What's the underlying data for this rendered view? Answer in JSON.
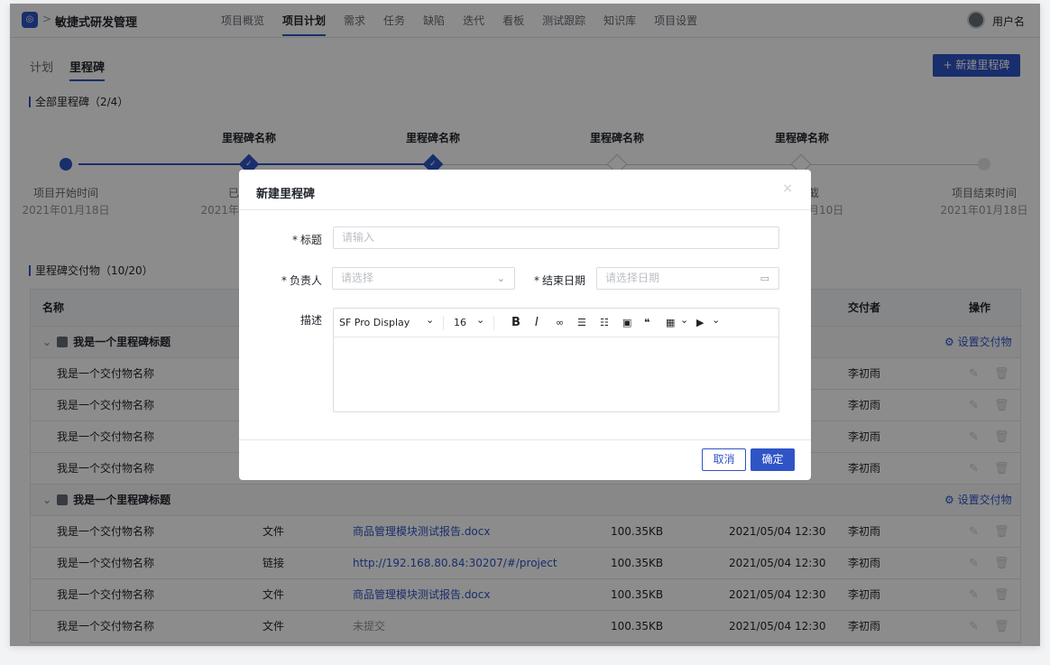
{
  "header": {
    "logo_icon": "app-logo-icon",
    "breadcrumb_sep": ">",
    "project_name": "敏捷式研发管理",
    "project_caret": "∨",
    "nav": [
      "项目概览",
      "项目计划",
      "需求",
      "任务",
      "缺陷",
      "迭代",
      "看板",
      "测试跟踪",
      "知识库",
      "项目设置"
    ],
    "nav_active_index": 1,
    "username": "用户名"
  },
  "tabs": [
    "计划",
    "里程碑"
  ],
  "new_button": "+ 新建里程碑",
  "timeline": {
    "section_title": "全部里程碑（2/4）",
    "milestones": [
      "里程碑名称",
      "里程碑名称",
      "里程碑名称",
      "里程碑名称"
    ],
    "start_label": "项目开始时间",
    "start_date": "2021年01月18日",
    "end_label": "项目结束时间",
    "end_date": "2021年01月18日",
    "partial_left_label": "已",
    "partial_left_date": "2021年",
    "partial_right_label": "截",
    "partial_right_date": "月10日",
    "completed_count": 2
  },
  "deliverables": {
    "section_title": "里程碑交付物（10/20）",
    "columns": {
      "name": "名称",
      "submitter": "交付者",
      "ops": "操作"
    },
    "group_title": "我是一个里程碑标题",
    "group_action": "⚙ 设置交付物",
    "row_name": "我是一个交付物名称",
    "submitter": "李初雨",
    "edit_icon": "✎",
    "delete_icon": "🗑",
    "rows2": [
      {
        "type": "文件",
        "link": "商品管理模块测试报告.docx",
        "size": "100.35KB",
        "time": "2021/05/04 12:30",
        "kind": "link"
      },
      {
        "type": "链接",
        "link": "http://192.168.80.84:30207/#/project",
        "size": "100.35KB",
        "time": "2021/05/04 12:30",
        "kind": "link"
      },
      {
        "type": "文件",
        "link": "商品管理模块测试报告.docx",
        "size": "100.35KB",
        "time": "2021/05/04 12:30",
        "kind": "link"
      },
      {
        "type": "文件",
        "link": "未提交",
        "size": "100.35KB",
        "time": "2021/05/04 12:30",
        "kind": "muted"
      }
    ]
  },
  "modal": {
    "title": "新建里程碑",
    "close": "×",
    "title_label": "标题",
    "title_placeholder": "请输入",
    "owner_label": "负责人",
    "owner_placeholder": "请选择",
    "end_date_label": "结束日期",
    "end_date_placeholder": "请选择日期",
    "desc_label": "描述",
    "required_mark": "*",
    "editor": {
      "font": "SF Pro Display",
      "size": "16",
      "caret": "⌄"
    },
    "cancel": "取消",
    "confirm": "确定"
  },
  "colors": {
    "primary": "#2f54c6"
  }
}
